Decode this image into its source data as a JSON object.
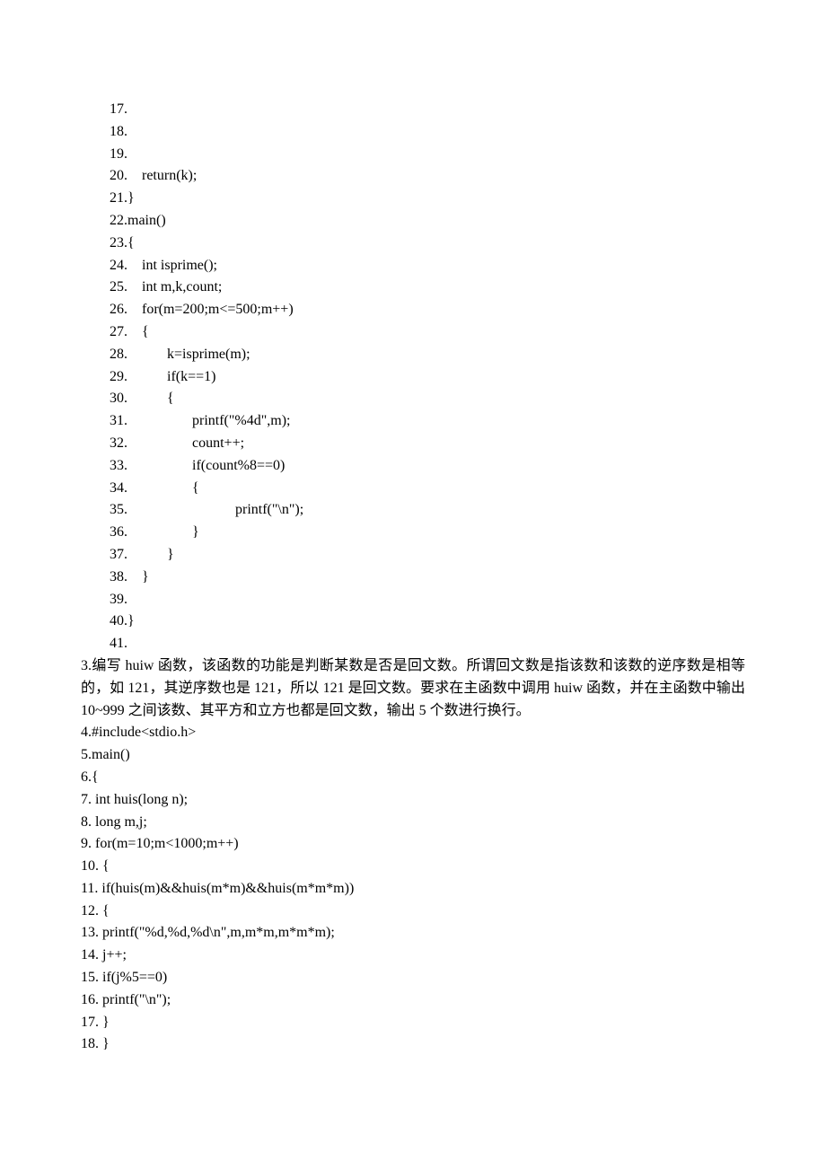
{
  "code_block_a": [
    "17. ",
    "18. ",
    "19. ",
    "20.    return(k);",
    "21.}",
    "22.main()",
    "23.{",
    "24.    int isprime();",
    "25.    int m,k,count;",
    "26.    for(m=200;m<=500;m++)",
    "27.    {",
    "28.           k=isprime(m);",
    "29.           if(k==1)",
    "30.           {",
    "31.                  printf(\"%4d\",m);",
    "32.                  count++;",
    "33.                  if(count%8==0)",
    "34.                  {",
    "35.                              printf(\"\\n\");",
    "36.                  }",
    "37.           }",
    "38.    }",
    "39. ",
    "40.}",
    "41. "
  ],
  "prose_lines": [
    "3.编写 huiw 函数，该函数的功能是判断某数是否是回文数。所谓回文数是指该数和该数的逆序数是相等的，如 121，其逆序数也是 121，所以 121 是回文数。要求在主函数中调用 huiw 函数，并在主函数中输出 10~999 之间该数、其平方和立方也都是回文数，输出 5 个数进行换行。",
    "4.#include<stdio.h>",
    "5.main()",
    "6.{",
    "7.       int huis(long n);",
    "8.       long m,j;",
    "9.       for(m=10;m<1000;m++)",
    "10.     {",
    "11.            if(huis(m)&&huis(m*m)&&huis(m*m*m))",
    "12.            {",
    "13.                   printf(\"%d,%d,%d\\n\",m,m*m,m*m*m);",
    "14.                   j++;",
    "15.                   if(j%5==0)",
    "16.                   printf(\"\\n\");",
    "17.            }",
    "18.     }"
  ]
}
